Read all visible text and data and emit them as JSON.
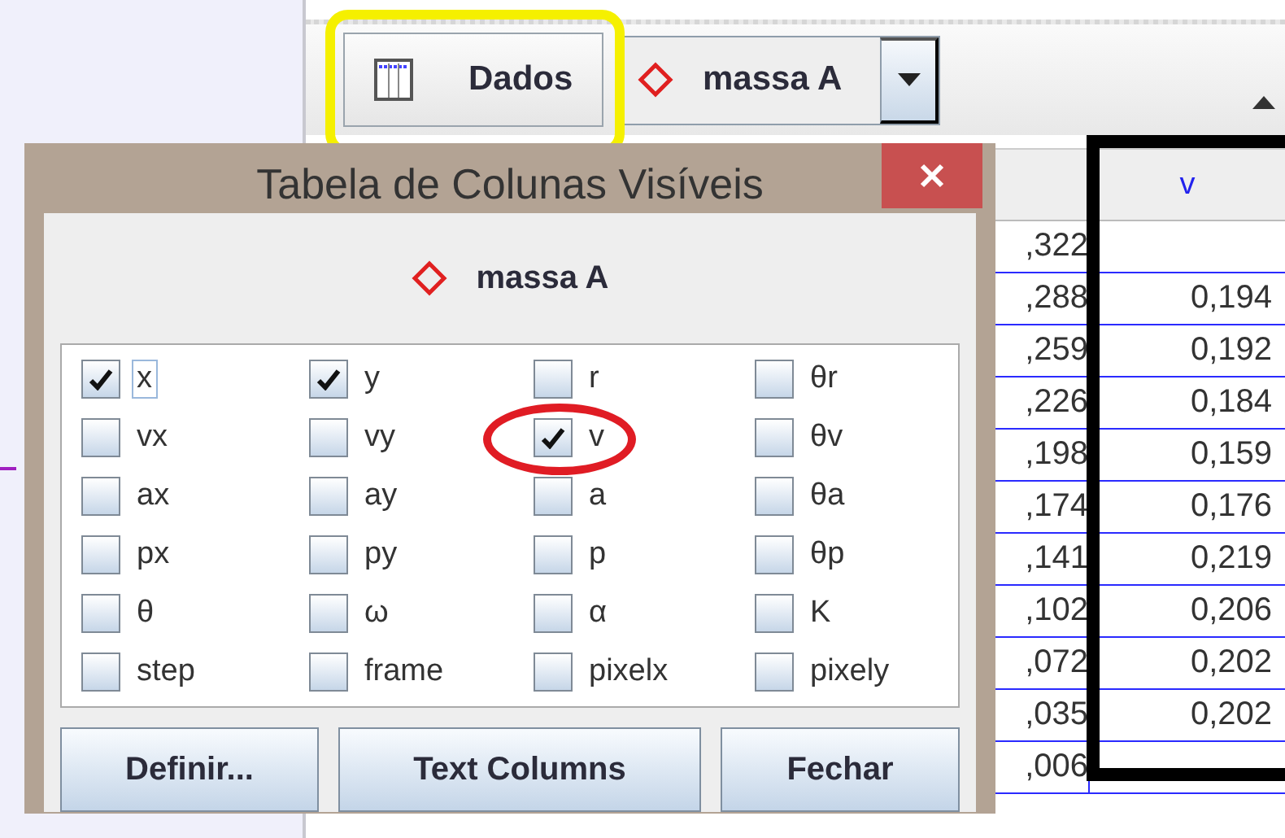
{
  "toolbar": {
    "data_button": "Dados",
    "object_selector": "massa A"
  },
  "dialog": {
    "title": "Tabela de Colunas Visíveis",
    "object": "massa A",
    "columns": [
      {
        "label": "x",
        "checked": true,
        "focused": true
      },
      {
        "label": "y",
        "checked": true,
        "focused": false
      },
      {
        "label": "r",
        "checked": false,
        "focused": false
      },
      {
        "label": "θr",
        "checked": false,
        "focused": false
      },
      {
        "label": "vx",
        "checked": false,
        "focused": false
      },
      {
        "label": "vy",
        "checked": false,
        "focused": false
      },
      {
        "label": "v",
        "checked": true,
        "focused": false
      },
      {
        "label": "θv",
        "checked": false,
        "focused": false
      },
      {
        "label": "ax",
        "checked": false,
        "focused": false
      },
      {
        "label": "ay",
        "checked": false,
        "focused": false
      },
      {
        "label": "a",
        "checked": false,
        "focused": false
      },
      {
        "label": "θa",
        "checked": false,
        "focused": false
      },
      {
        "label": "px",
        "checked": false,
        "focused": false
      },
      {
        "label": "py",
        "checked": false,
        "focused": false
      },
      {
        "label": "p",
        "checked": false,
        "focused": false
      },
      {
        "label": "θp",
        "checked": false,
        "focused": false
      },
      {
        "label": "θ",
        "checked": false,
        "focused": false
      },
      {
        "label": "ω",
        "checked": false,
        "focused": false
      },
      {
        "label": "α",
        "checked": false,
        "focused": false
      },
      {
        "label": "K",
        "checked": false,
        "focused": false
      },
      {
        "label": "step",
        "checked": false,
        "focused": false
      },
      {
        "label": "frame",
        "checked": false,
        "focused": false
      },
      {
        "label": "pixelx",
        "checked": false,
        "focused": false
      },
      {
        "label": "pixely",
        "checked": false,
        "focused": false
      }
    ],
    "buttons": [
      "Definir...",
      "Text Columns",
      "Fechar"
    ]
  },
  "table": {
    "columns": [
      "v"
    ],
    "rows": [
      {
        "column_1": ",322"
      },
      {
        "column_1": ",288",
        "v": "0,194"
      },
      {
        "column_1": ",259",
        "v": "0,192"
      },
      {
        "column_1": ",226",
        "v": "0,184"
      },
      {
        "column_1": ",198",
        "v": "0,159"
      },
      {
        "column_1": ",174",
        "v": "0,176"
      },
      {
        "column_1": ",141",
        "v": "0,219"
      },
      {
        "column_1": ",102",
        "v": "0,206"
      },
      {
        "column_1": ",072",
        "v": "0,202"
      },
      {
        "column_1": ",035",
        "v": "0,202"
      },
      {
        "column_1": ",006"
      }
    ]
  }
}
